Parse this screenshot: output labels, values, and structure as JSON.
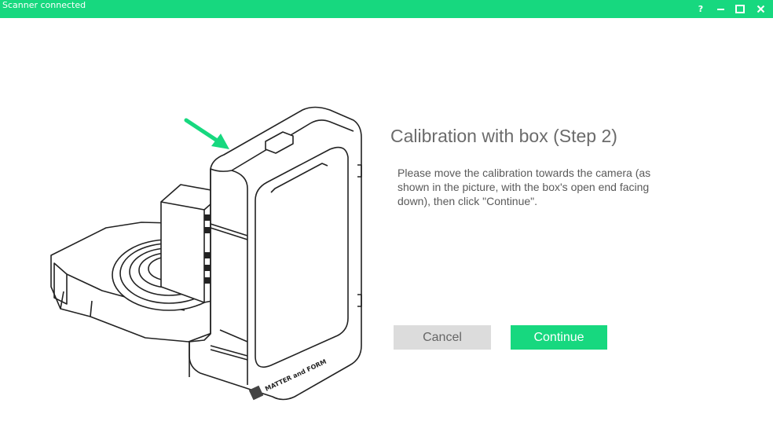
{
  "theme": {
    "accent": "#17d87f"
  },
  "titlebar": {
    "status": "Scanner connected",
    "help_label": "?",
    "icons": [
      "help-icon",
      "minimize-icon",
      "maximize-icon",
      "close-icon"
    ]
  },
  "illustration": {
    "logo_text": "matter and form",
    "arrow_color": "#17d87f"
  },
  "main": {
    "title": "Calibration with box (Step 2)",
    "instructions": "Please move the calibration towards the camera (as shown in the picture, with the box's open end facing down), then click \"Continue\"."
  },
  "buttons": {
    "cancel": "Cancel",
    "continue": "Continue"
  }
}
